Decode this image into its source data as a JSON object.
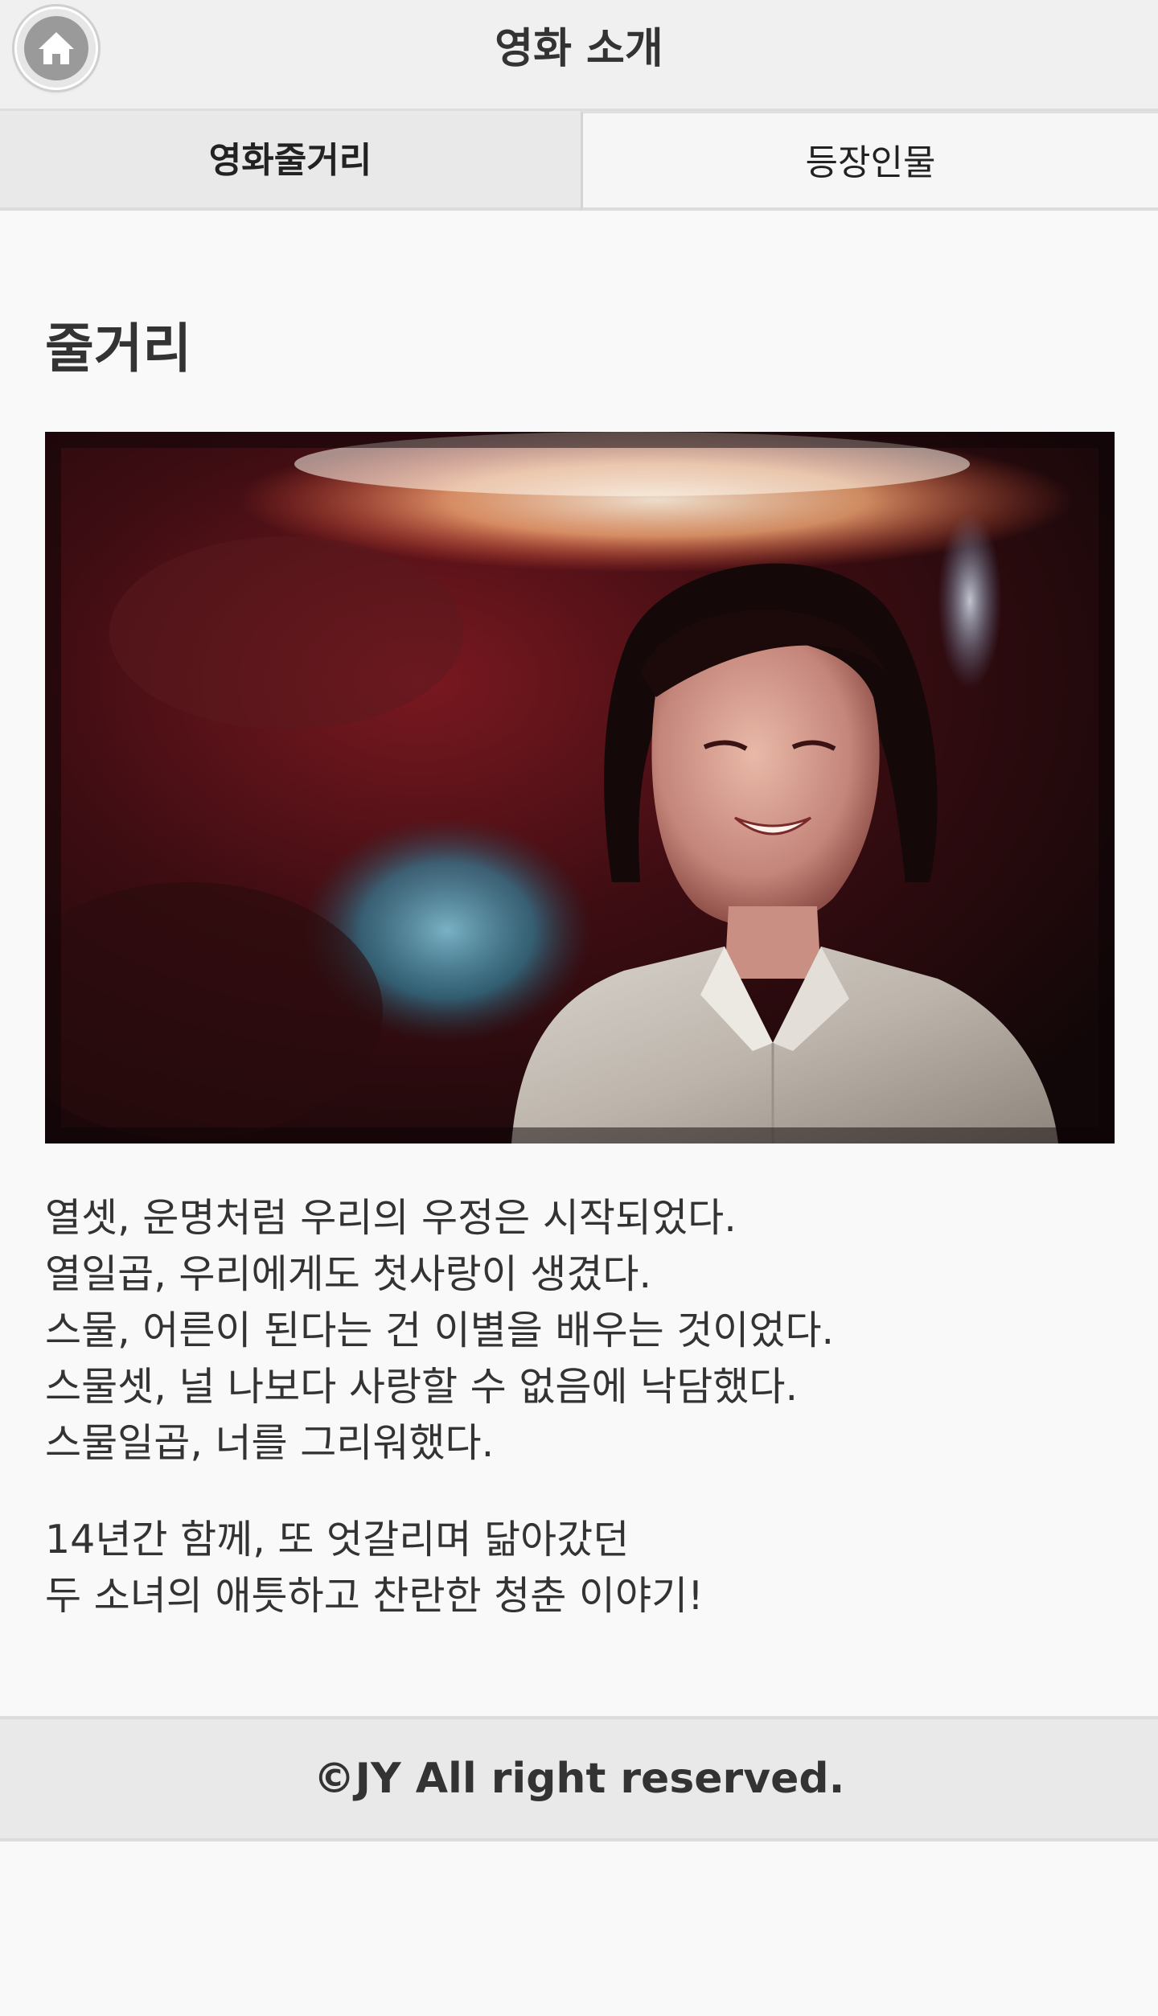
{
  "header": {
    "title": "영화 소개",
    "home_icon": "home-icon"
  },
  "tabs": [
    {
      "label": "영화줄거리",
      "active": true
    },
    {
      "label": "등장인물",
      "active": false
    }
  ],
  "main": {
    "section_title": "줄거리",
    "image_description_icon": "movie-still-image",
    "paragraphs": [
      {
        "lines": [
          "열셋, 운명처럼 우리의 우정은 시작되었다.",
          "열일곱, 우리에게도 첫사랑이 생겼다.",
          "스물, 어른이 된다는 건 이별을 배우는 것이었다.",
          "스물셋, 널 나보다 사랑할 수 없음에 낙담했다.",
          "스물일곱, 너를 그리워했다."
        ]
      },
      {
        "lines": [
          "14년간 함께, 또 엇갈리며 닮아갔던",
          "두 소녀의 애틋하고 찬란한 청춘 이야기!"
        ]
      }
    ]
  },
  "footer": {
    "text": "©JY All right reserved."
  },
  "colors": {
    "header_bg": "#f0f0f0",
    "active_tab_bg": "#e9e9e9",
    "page_bg": "#f9f9f9",
    "text": "#333333"
  }
}
